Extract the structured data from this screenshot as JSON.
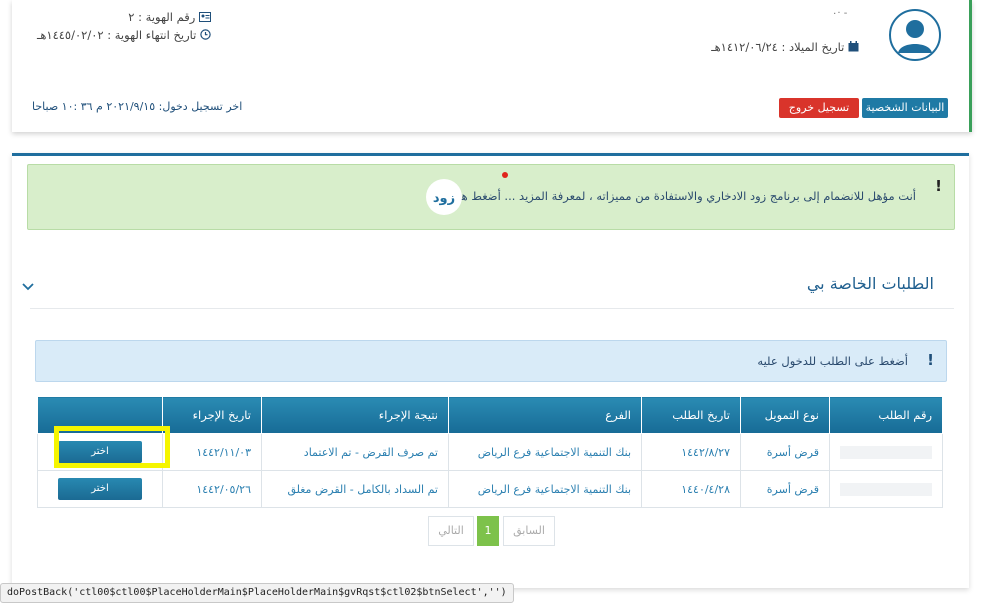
{
  "profile": {
    "id_number_label": "رقم الهوية : ٢",
    "id_expiry_label": "تاريخ انتهاء الهوية : ١٤٤٥/٠٢/٠٢هـ",
    "birth_date_label": "تاريخ الميلاد : ١٤١٢/٠٦/٢٤هـ",
    "name_placeholder": "- ·٠",
    "last_login": "اخر تسجيل دخول: ٢٠٢١/٩/١٥ م ٣٦ :١٠ صباحا",
    "personal_data_button": "البيانات الشخصية",
    "logout_button": "تسجيل خروج"
  },
  "banner": {
    "text": "أنت مؤهل للانضمام إلى برنامج زود الادخاري والاستفادة من مميزاته ، لمعرفة المزيد ... أضغط هنا",
    "logo_text": "زود",
    "exclaim": "!"
  },
  "section": {
    "title": "الطلبات الخاصة بي",
    "info_text": "أضغط على الطلب للدخول عليه",
    "info_exclaim": "!"
  },
  "table": {
    "headers": [
      "رقم الطلب",
      "نوع التمويل",
      "تاريخ الطلب",
      "الفرع",
      "نتيجة الإجراء",
      "تاريخ الإجراء",
      ""
    ],
    "rows": [
      {
        "request_no": "",
        "type": "قرض أسرة",
        "date": "١٤٤٢/٨/٢٧",
        "branch": "بنك التنمية الاجتماعية فرع الرياض",
        "result": "تم صرف القرض - تم الاعتماد",
        "action_date": "١٤٤٢/١١/٠٣",
        "button": "اختر"
      },
      {
        "request_no": "",
        "type": "قرض أسرة",
        "date": "١٤٤٠/٤/٢٨",
        "branch": "بنك التنمية الاجتماعية فرع الرياض",
        "result": "تم السداد بالكامل - القرض مغلق",
        "action_date": "١٤٤٢/٠٥/٢٦",
        "button": "اختر"
      }
    ]
  },
  "pagination": {
    "prev": "السابق",
    "current": "1",
    "next": "التالي"
  },
  "status_tip": "doPostBack('ctl00$ctl00$PlaceHolderMain$PlaceHolderMain$gvRqst$ctl02$btnSelect','')",
  "colors": {
    "accent_blue": "#1f6e9e",
    "logout_red": "#d9342b",
    "page_green": "#7dc24b",
    "highlight_yellow": "#f5f500"
  },
  "icons": [
    "id-card-icon",
    "clock-icon",
    "calendar-icon",
    "avatar-icon",
    "chevron-down-icon",
    "zood-logo"
  ]
}
